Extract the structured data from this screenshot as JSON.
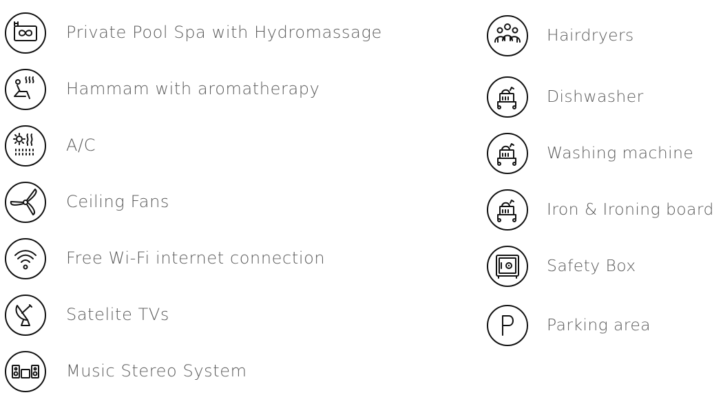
{
  "amenities": {
    "left_column": [
      {
        "label": "Private Pool Spa with Hydromassage",
        "icon": "pool-infinity-icon"
      },
      {
        "label": "Hammam with aromatherapy",
        "icon": "hammam-steam-icon"
      },
      {
        "label": "A/C",
        "icon": "air-conditioning-icon"
      },
      {
        "label": "Ceiling Fans",
        "icon": "ceiling-fan-icon"
      },
      {
        "label": "Free Wi-Fi internet connection",
        "icon": "wifi-icon"
      },
      {
        "label": "Satelite TVs",
        "icon": "satellite-dish-icon"
      },
      {
        "label": "Music Stereo System",
        "icon": "stereo-speakers-icon"
      }
    ],
    "right_column": [
      {
        "label": "Hairdryers",
        "icon": "people-group-icon"
      },
      {
        "label": "Dishwasher",
        "icon": "cart-appliance-icon"
      },
      {
        "label": "Washing machine",
        "icon": "cart-appliance-icon"
      },
      {
        "label": "Iron & Ironing board",
        "icon": "cart-appliance-icon"
      },
      {
        "label": "Safety Box",
        "icon": "safe-icon"
      },
      {
        "label": "Parking area",
        "icon": "parking-icon"
      }
    ]
  }
}
